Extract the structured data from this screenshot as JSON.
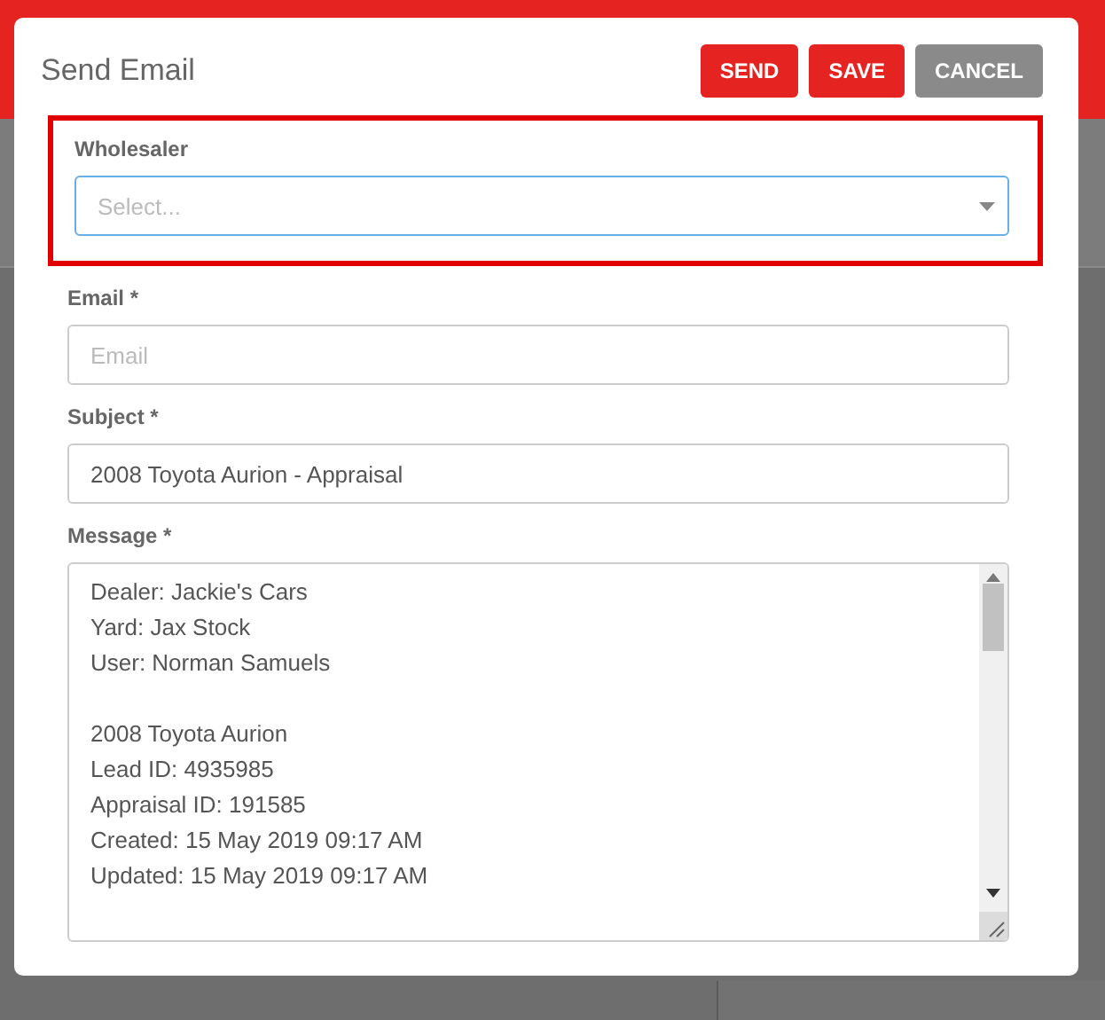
{
  "dialog": {
    "title": "Send Email",
    "buttons": [
      {
        "label": "SEND",
        "kind": "primary"
      },
      {
        "label": "SAVE",
        "kind": "primary"
      },
      {
        "label": "CANCEL",
        "kind": "secondary"
      }
    ],
    "fields": [
      {
        "label": "Wholesaler",
        "kind": "select",
        "placeholder": "Select...",
        "focused": true,
        "highlighted": true
      },
      {
        "label": "Email *",
        "kind": "text",
        "placeholder": "Email",
        "focused": false,
        "highlighted": false
      },
      {
        "label": "Subject *",
        "kind": "text",
        "value": "2008 Toyota Aurion - Appraisal",
        "focused": false,
        "highlighted": false
      }
    ],
    "message": {
      "label": "Message *",
      "paragraphs": [
        [
          "Dealer: Jackie's Cars",
          "Yard: Jax Stock",
          "User: Norman Samuels"
        ],
        [
          "2008 Toyota Aurion",
          "Lead ID: 4935985",
          "Appraisal ID: 191585",
          "Created: 15 May 2019 09:17 AM",
          "Updated: 15 May 2019 09:17 AM"
        ]
      ]
    }
  }
}
